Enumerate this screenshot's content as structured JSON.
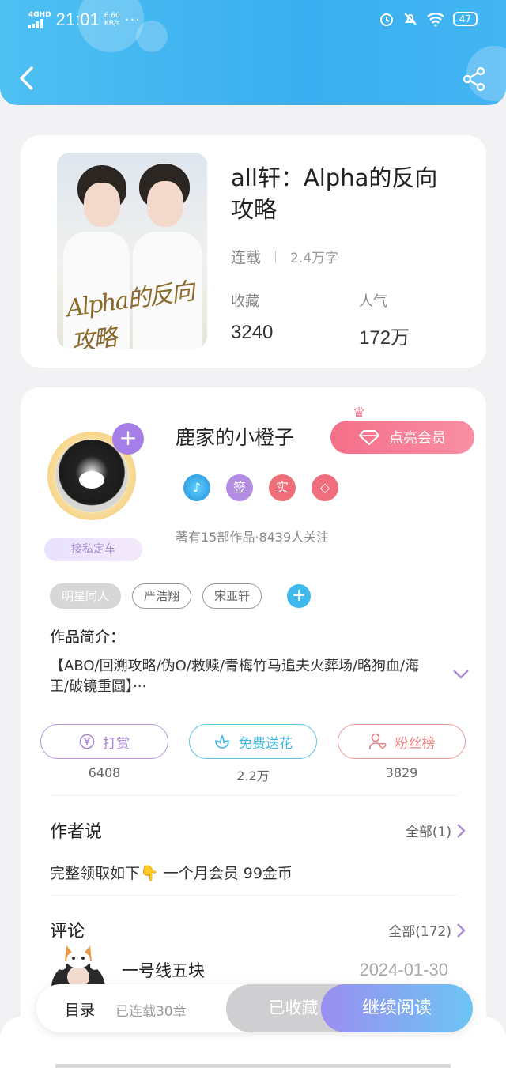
{
  "status_bar": {
    "network": "4GHD",
    "time": "21:01",
    "speed_value": "6.60",
    "speed_unit": "KB/s",
    "more": "···",
    "battery": "47"
  },
  "book": {
    "title": "all轩：Alpha的反向攻略",
    "cover_text": "Alpha的反向攻略",
    "status": "连载",
    "words": "2.4万字",
    "favorites_label": "收藏",
    "favorites_value": "3240",
    "popularity_label": "人气",
    "popularity_value": "172万"
  },
  "author": {
    "name": "鹿家的小橙子",
    "vip_button": "点亮会员",
    "badges": [
      "签",
      "实"
    ],
    "stats": "著有15部作品·8439人关注",
    "private_tag": "接私定车"
  },
  "tags": [
    "明星同人",
    "严浩翔",
    "宋亚轩"
  ],
  "intro": {
    "title": "作品简介：",
    "text": "【ABO/回溯攻略/伪O/救赎/青梅竹马追夫火葬场/略狗血/海王/破镜重圆】···"
  },
  "actions": [
    {
      "label": "打赏",
      "count": "6408",
      "color": "#a884d6"
    },
    {
      "label": "免费送花",
      "count": "2.2万",
      "color": "#3db7e4"
    },
    {
      "label": "粉丝榜",
      "count": "3829",
      "color": "#e9817f"
    }
  ],
  "author_says": {
    "title": "作者说",
    "more": "全部(1)",
    "text": "完整领取如下👇 一个月会员 99金币"
  },
  "comments": {
    "title": "评论",
    "more": "全部(172)",
    "first_user": "一号线五块",
    "first_date": "2024-01-30"
  },
  "bottom_bar": {
    "toc": "目录",
    "chapters": "已连载30章",
    "saved": "已收藏",
    "read": "继续阅读"
  },
  "colors": {
    "header": "#3aaef0",
    "vip": "#f56f8a",
    "purple": "#a57ee8"
  }
}
